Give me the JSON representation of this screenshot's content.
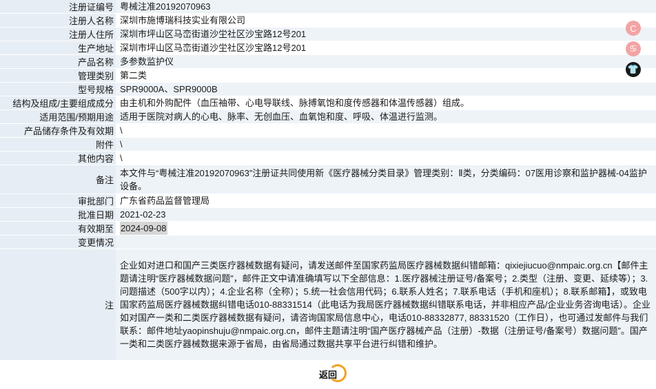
{
  "rows": [
    {
      "label": "注册证编号",
      "value": "粤械注准20192070963"
    },
    {
      "label": "注册人名称",
      "value": "深圳市施博瑞科技实业有限公司"
    },
    {
      "label": "注册人住所",
      "value": "深圳市坪山区马峦街道沙坣社区沙宝路12号201"
    },
    {
      "label": "生产地址",
      "value": "深圳市坪山区马峦街道沙坣社区沙宝路12号201"
    },
    {
      "label": "产品名称",
      "value": "多参数监护仪"
    },
    {
      "label": "管理类别",
      "value": "第二类"
    },
    {
      "label": "型号规格",
      "value": "SPR9000A、SPR9000B"
    },
    {
      "label": "结构及组成/主要组成成分",
      "value": "由主机和外购配件（血压袖带、心电导联线、脉搏氧饱和度传感器和体温传感器）组成。"
    },
    {
      "label": "适用范围/预期用途",
      "value": "适用于医院对病人的心电、脉率、无创血压、血氧饱和度、呼吸、体温进行监测。"
    },
    {
      "label": "产品储存条件及有效期",
      "value": "\\"
    },
    {
      "label": "附件",
      "value": "\\"
    },
    {
      "label": "其他内容",
      "value": "\\"
    },
    {
      "label": "备注",
      "value": "本文件与“粤械注准20192070963”注册证共同使用新《医疗器械分类目录》管理类别：Ⅱ类，分类编码：07医用诊察和监护器械-04监护设备。"
    },
    {
      "label": "审批部门",
      "value": "广东省药品监督管理局"
    },
    {
      "label": "批准日期",
      "value": "2021-02-23"
    },
    {
      "label": "有效期至",
      "value": "2024-09-08"
    },
    {
      "label": "变更情况",
      "value": ""
    },
    {
      "label": "注",
      "value": "企业如对进口和国产三类医疗器械数据有疑问，请发送邮件至国家药监局医疗器械数据纠错邮箱：qixiejiucuo@nmpaic.org.cn【邮件主题请注明“医疗器械数据问题”，邮件正文中请准确填写以下全部信息：1.医疗器械注册证号/备案号；2.类型（注册、变更、延续等）；3.问题描述（500字以内）；4.企业名称（全称）；5.统一社会信用代码；6.联系人姓名；7.联系电话（手机和座机）；8.联系邮箱】，或致电国家药监局医疗器械数据纠错电话010-88331514（此电话为我局医疗器械数据纠错联系电话，并非相应产品/企业业务咨询电话）。企业如对国产一类和二类医疗器械数据有疑问，请咨询国家局信息中心，电话010-88332877, 88331520（工作日），也可通过发邮件与我们联系：邮件地址yaopinshuju@nmpaic.org.cn，邮件主题请注明“国产医疗器械产品（注册）-数据（注册证号/备案号）数据问题”。国产一类和二类医疗器械数据来源于省局，由省局通过数据共享平台进行纠错和维护。"
    }
  ],
  "back_label": "返回",
  "float_icons": [
    "c-logo-icon",
    "share-icon",
    "shirt-icon"
  ],
  "float_icon_glyphs": [
    "C",
    "♋",
    "👕"
  ]
}
